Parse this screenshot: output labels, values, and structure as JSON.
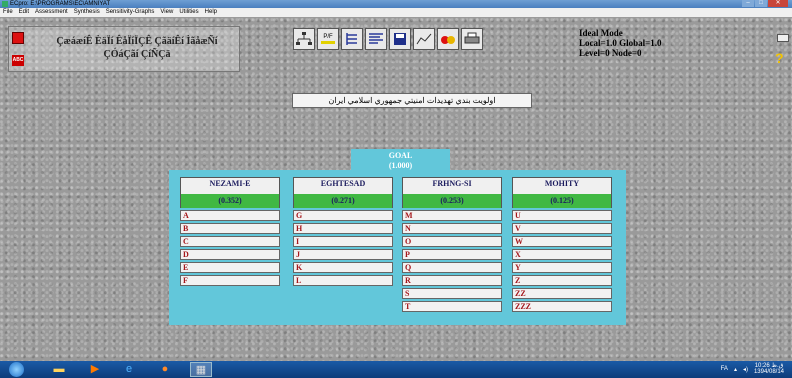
{
  "window": {
    "title": "ECpro: E:\\PROGRAMS\\EC\\AMNIYAT"
  },
  "menu": [
    "File",
    "Edit",
    "Assessment",
    "Synthesis",
    "Sensitivity-Graphs",
    "View",
    "Utilities",
    "Help"
  ],
  "model": {
    "name_line1": "ÇæáæíÊ ÈäÏí ÊåÏíÏÇÊ ÇãäíÊí ÌãåæÑí",
    "name_line2": "ÇÓáÇãí ÇíÑÇä"
  },
  "toolbar": {
    "icons": [
      "hierarchy-icon",
      "pf-icon",
      "tree-icon",
      "list-icon",
      "save-icon",
      "graph-icon",
      "fruit-icon",
      "print-icon"
    ],
    "pf_label": "P/F"
  },
  "status": {
    "mode": "Ideal Mode",
    "inconsistency": "Local=1.0 Global=1.0",
    "level": "Level=0  Node=0"
  },
  "goal_description": "اولويت بندي تهديدات امنيتي جمهوري اسلامي ايران",
  "goal": {
    "label": "GOAL",
    "value": "(1.000)"
  },
  "criteria": [
    {
      "name": "NEZAMI-E",
      "value": "(0.352)",
      "children": [
        "A",
        "B",
        "C",
        "D",
        "E",
        "F"
      ]
    },
    {
      "name": "EGHTESAD",
      "value": "(0.271)",
      "children": [
        "G",
        "H",
        "I",
        "J",
        "K",
        "L"
      ]
    },
    {
      "name": "FRHNG-SI",
      "value": "(0.253)",
      "children": [
        "M",
        "N",
        "O",
        "P",
        "Q",
        "R",
        "S",
        "T"
      ]
    },
    {
      "name": "MOHITY",
      "value": "(0.125)",
      "children": [
        "U",
        "V",
        "W",
        "X",
        "Y",
        "Z",
        "ZZ",
        "ZZZ"
      ]
    }
  ],
  "taskbar": {
    "lang": "FA",
    "time": "10:26 ق.ظ",
    "date": "1394/08/14"
  }
}
